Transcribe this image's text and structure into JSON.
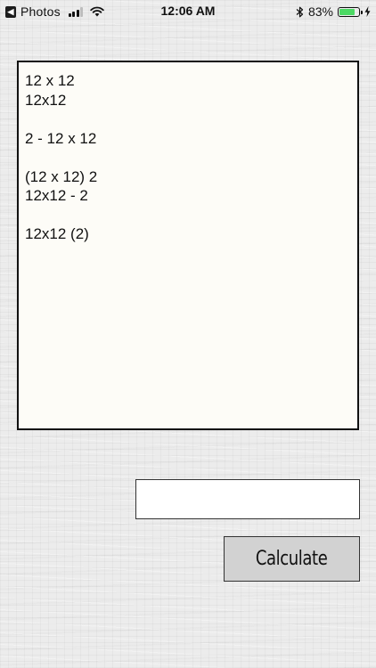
{
  "status_bar": {
    "back_app": "Photos",
    "time": "12:06 AM",
    "battery_percent": "83%",
    "battery_level": 0.83,
    "signal_bars": 3,
    "signal_max": 4
  },
  "notes": {
    "text": "12 x 12\n12x12\n\n2 - 12 x 12\n\n(12 x 12) 2\n12x12 - 2\n\n12x12 (2)"
  },
  "result": {
    "value": ""
  },
  "calculate_button": {
    "label": "Calculate"
  },
  "colors": {
    "battery_fill": "#4cd964",
    "button_bg": "#d2d2d2",
    "notes_bg": "#fdfcf7"
  }
}
